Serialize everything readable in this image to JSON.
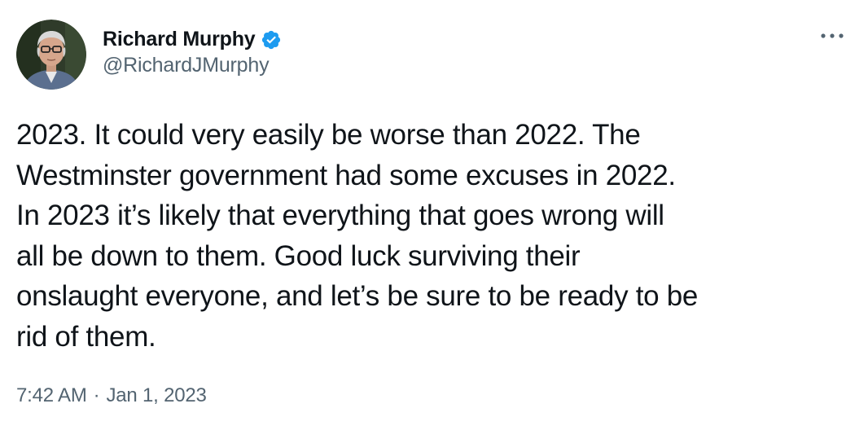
{
  "author": {
    "display_name": "Richard Murphy",
    "handle": "@RichardJMurphy",
    "verified": true,
    "avatar_icon": "profile-photo",
    "verified_color": "#1d9bf0"
  },
  "menu": {
    "icon": "more-horizontal-icon"
  },
  "tweet": {
    "lines": [
      "2023. It could very easily be worse than 2022. The",
      "Westminster government had some excuses in 2022.",
      "In 2023 it’s likely that everything that goes wrong will",
      "all be down to them. Good luck surviving their",
      "onslaught everyone, and let’s be sure to be ready to be",
      "rid of them."
    ]
  },
  "meta": {
    "time": "7:42 AM",
    "separator": "·",
    "date": "Jan 1, 2023"
  },
  "colors": {
    "text": "#0f1419",
    "secondary": "#536471",
    "accent": "#1d9bf0"
  }
}
